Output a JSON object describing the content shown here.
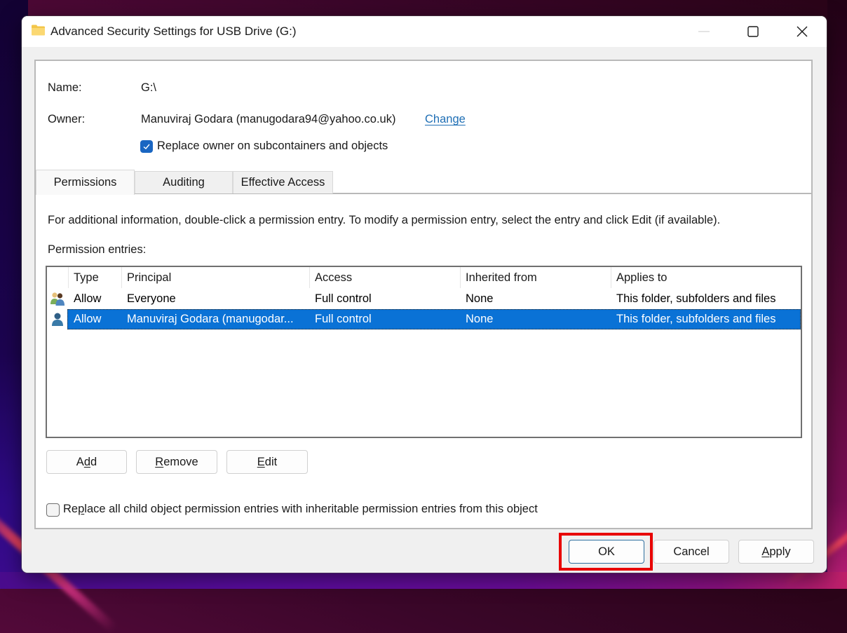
{
  "window": {
    "title": "Advanced Security Settings for USB Drive (G:)",
    "controls": {
      "minimize": "minimize-icon",
      "maximize": "maximize-icon",
      "close": "close-icon"
    }
  },
  "info": {
    "name_label": "Name:",
    "name_value": "G:\\",
    "owner_label": "Owner:",
    "owner_value": "Manuviraj Godara (manugodara94@yahoo.co.uk)",
    "change_link": "Change",
    "replace_owner_label": "Replace owner on subcontainers and objects",
    "replace_owner_checked": true
  },
  "tabs": [
    {
      "label": "Permissions",
      "active": true
    },
    {
      "label": "Auditing",
      "active": false
    },
    {
      "label": "Effective Access",
      "active": false
    }
  ],
  "permissions": {
    "info_text": "For additional information, double-click a permission entry. To modify a permission entry, select the entry and click Edit (if available).",
    "entries_label": "Permission entries:",
    "columns": [
      "Type",
      "Principal",
      "Access",
      "Inherited from",
      "Applies to"
    ],
    "rows": [
      {
        "icon": "group-users-icon",
        "type": "Allow",
        "principal": "Everyone",
        "access": "Full control",
        "inherited_from": "None",
        "applies_to": "This folder, subfolders and files",
        "selected": false
      },
      {
        "icon": "user-icon",
        "type": "Allow",
        "principal": "Manuviraj Godara (manugodar...",
        "access": "Full control",
        "inherited_from": "None",
        "applies_to": "This folder, subfolders and files",
        "selected": true
      }
    ],
    "buttons": {
      "add": {
        "pre": "A",
        "mnemonic": "d",
        "post": "d"
      },
      "remove": {
        "pre": "",
        "mnemonic": "R",
        "post": "emove"
      },
      "edit": {
        "pre": "",
        "mnemonic": "E",
        "post": "dit"
      }
    },
    "replace_child": {
      "pre": "Re",
      "mnemonic": "p",
      "post": "lace all child object permission entries with inheritable permission entries from this object",
      "checked": false
    }
  },
  "footer": {
    "ok": "OK",
    "cancel": "Cancel",
    "apply": {
      "pre": "",
      "mnemonic": "A",
      "post": "pply"
    }
  },
  "annotation": {
    "highlight_target": "OK",
    "color": "#e80000"
  },
  "colors": {
    "selection": "#0a72d6",
    "link": "#1f6fb5",
    "checkbox": "#1a66c2"
  }
}
